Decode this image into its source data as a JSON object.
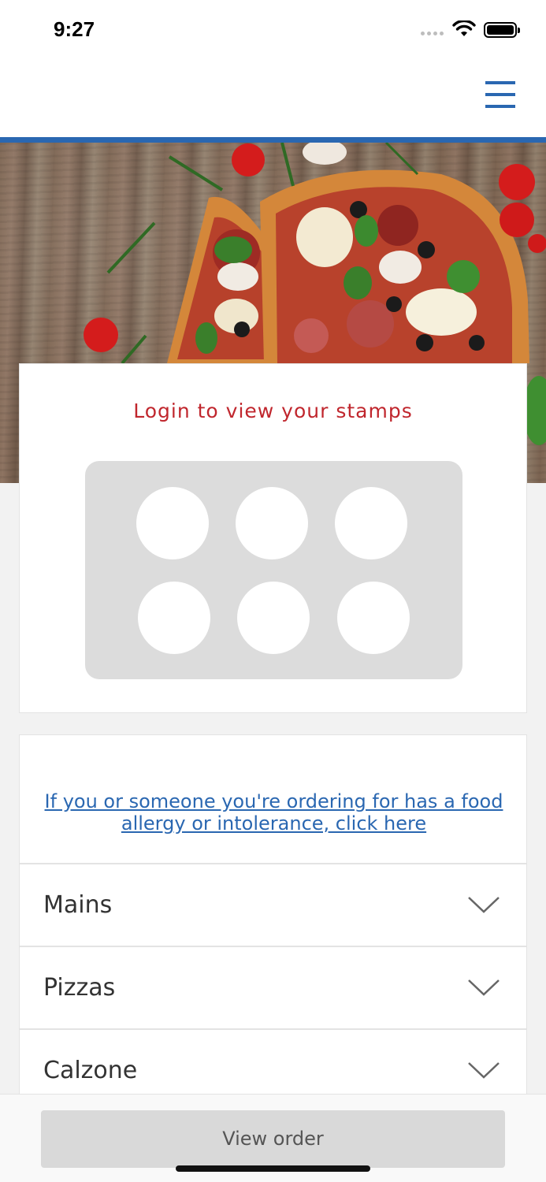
{
  "status_bar": {
    "time": "9:27"
  },
  "header": {
    "menu_icon": "hamburger-icon"
  },
  "stamps": {
    "title": "Login to view your stamps",
    "count": 6
  },
  "allergy": {
    "link_text": "If you or someone you're ordering for has a food allergy or intolerance, click here"
  },
  "categories": [
    {
      "label": "Mains",
      "icon": "chevron-down-icon"
    },
    {
      "label": "Pizzas",
      "icon": "chevron-down-icon"
    },
    {
      "label": "Calzone",
      "icon": "chevron-down-icon"
    }
  ],
  "footer": {
    "view_order_label": "View order"
  },
  "colors": {
    "brand_blue": "#2a67b1",
    "accent_red": "#c0262d"
  }
}
